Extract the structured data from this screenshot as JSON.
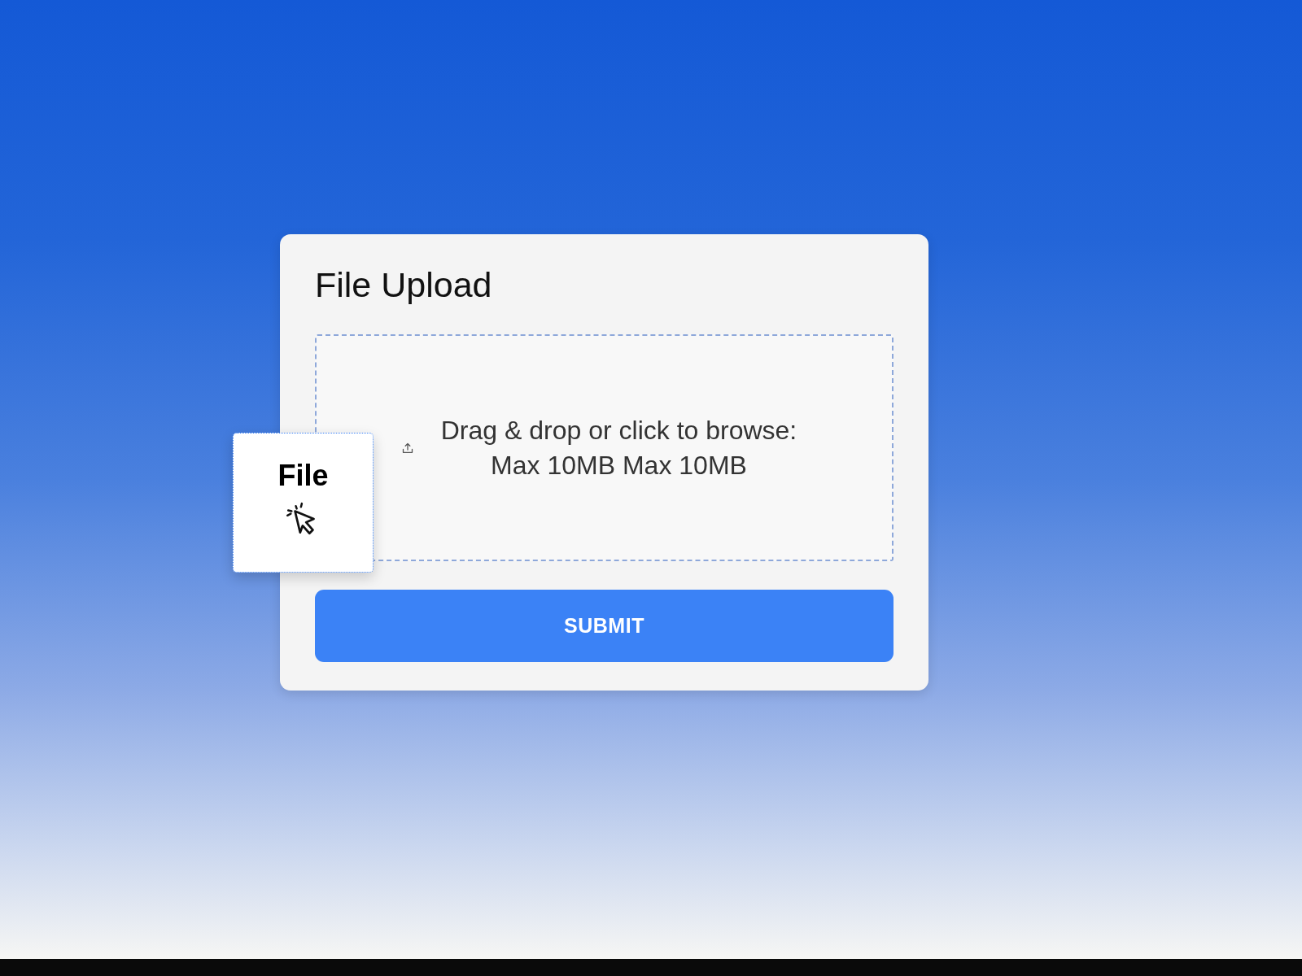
{
  "upload_card": {
    "title": "File Upload",
    "dropzone": {
      "text": "Drag & drop or click to browse: Max 10MB Max 10MB"
    },
    "drag_preview": {
      "label": "File"
    },
    "submit_button": {
      "label": "SUBMIT"
    }
  }
}
